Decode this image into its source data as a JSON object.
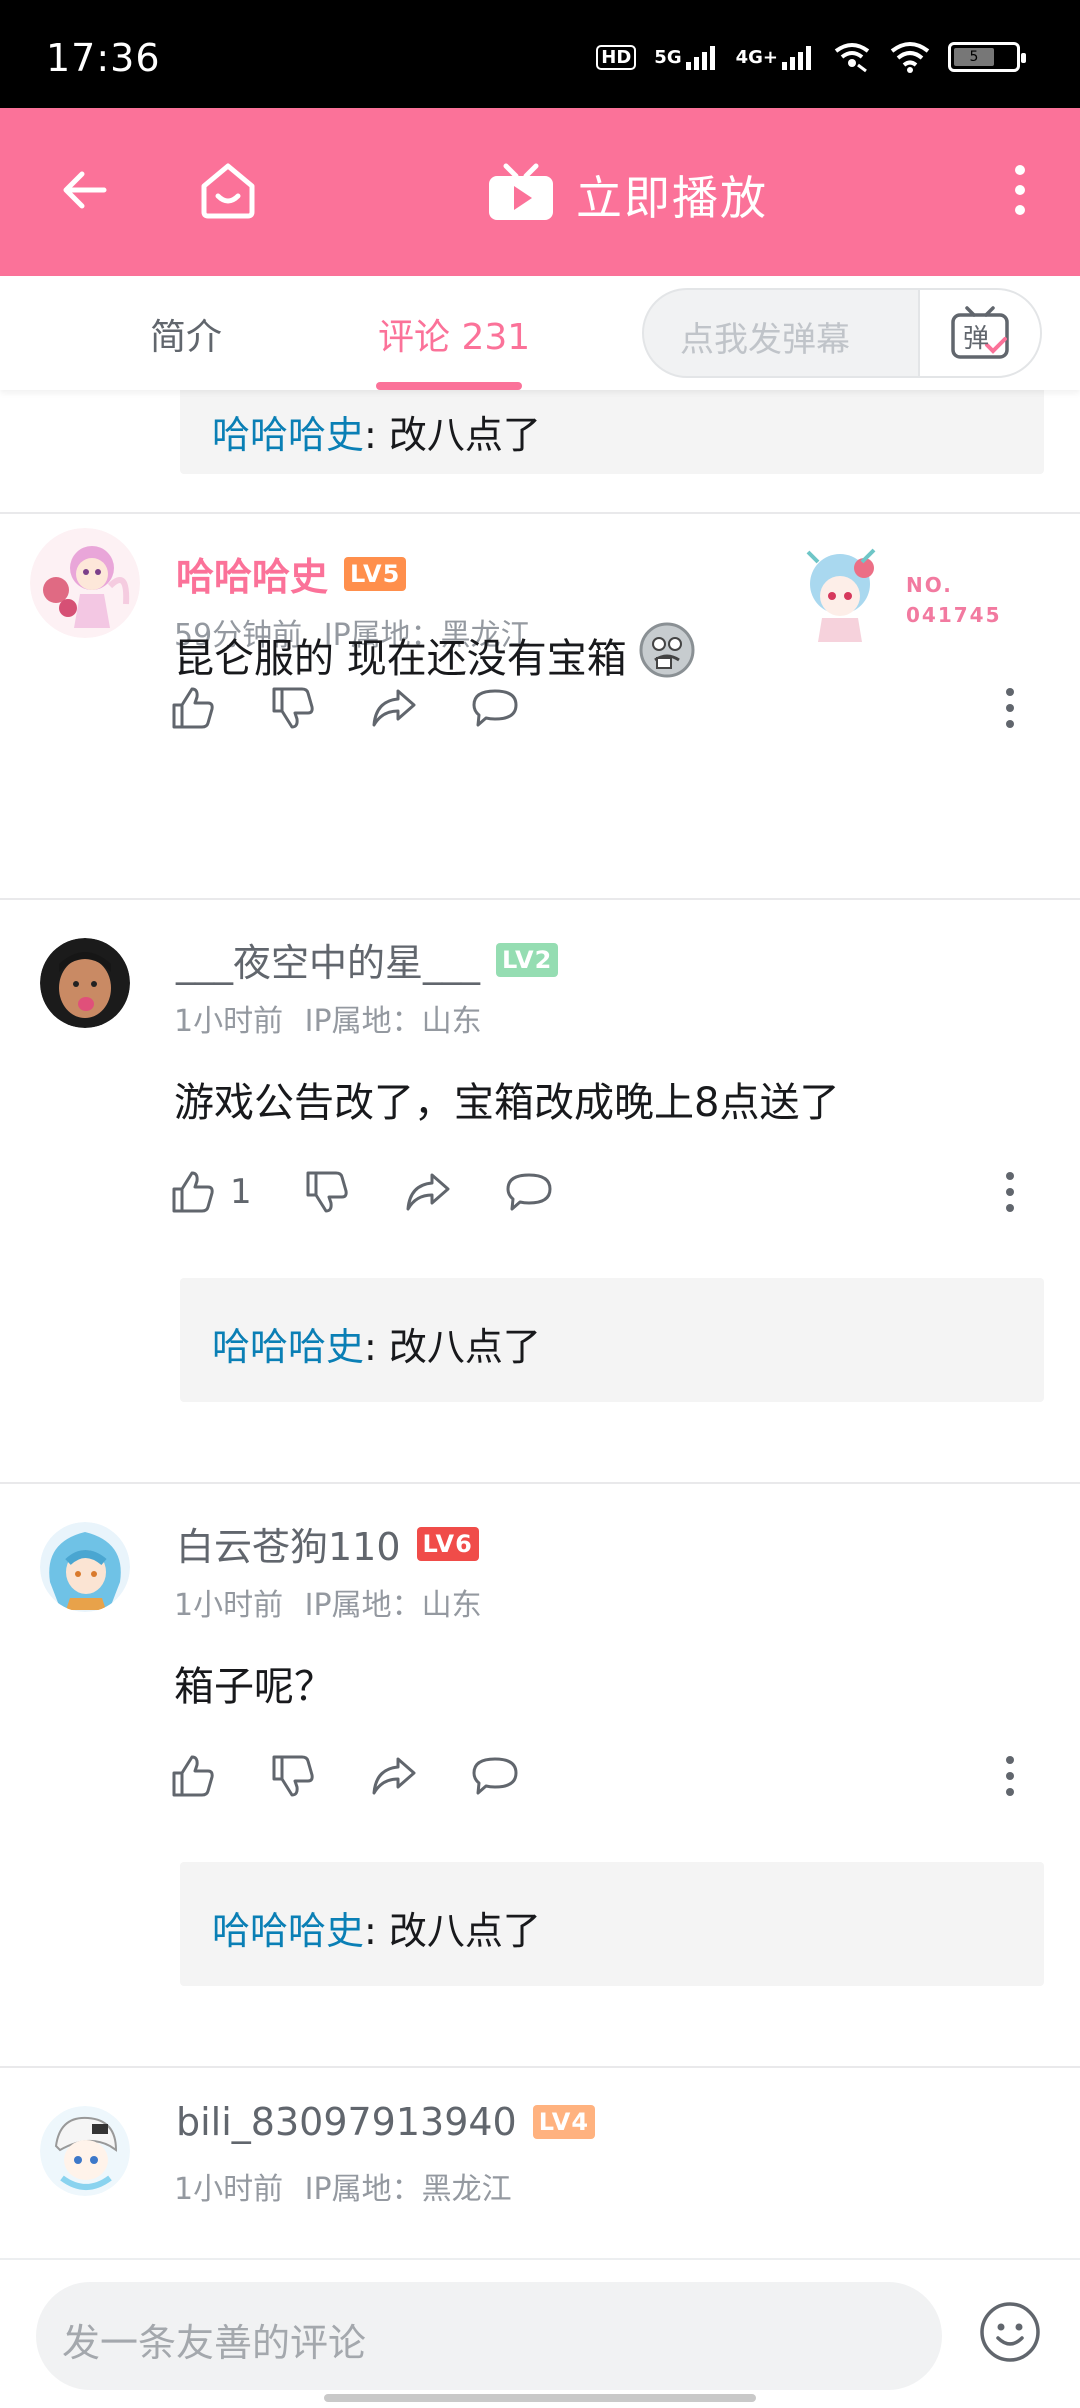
{
  "status_bar": {
    "time": "17:36",
    "hd_label": "HD",
    "net1": "5G",
    "net2": "4G+",
    "battery_level": "5"
  },
  "header": {
    "back_icon": "arrow-left-icon",
    "home_icon": "home-icon",
    "tv_icon": "bilibili-tv-icon",
    "play_label": "立即播放",
    "more_icon": "more-vertical-icon",
    "background": "#fb7299"
  },
  "tabs": {
    "intro": "简介",
    "comments": "评论",
    "comments_count": "231",
    "danmaku_placeholder": "点我发弹幕",
    "danmaku_btn": "弹"
  },
  "top_partial_reply": {
    "name": "哈哈哈史",
    "text": ": 改八点了"
  },
  "comments": [
    {
      "username": "哈哈哈史",
      "level": "LV5",
      "level_color": "#ff8f4c",
      "time": "59分钟前",
      "location": "IP属地：黑龙江",
      "text": "昆仑服的 现在还没有宝箱",
      "fan_badge": "NO.\n041745",
      "like_count": "",
      "reply": null
    },
    {
      "username": "___夜空中的星___",
      "level": "LV2",
      "level_color": "#95ddb2",
      "time": "1小时前",
      "location": "IP属地：山东",
      "text": "游戏公告改了，宝箱改成晚上8点送了",
      "like_count": "1",
      "reply": {
        "name": "哈哈哈史",
        "text": ": 改八点了"
      }
    },
    {
      "username": "白云苍狗110",
      "level": "LV6",
      "level_color": "#f04c49",
      "time": "1小时前",
      "location": "IP属地：山东",
      "text": "箱子呢？",
      "like_count": "",
      "reply": {
        "name": "哈哈哈史",
        "text": ": 改八点了"
      }
    },
    {
      "username": "bili_83097913940",
      "level": "LV4",
      "level_color": "#ffb27f",
      "time": "1小时前",
      "location": "IP属地：黑龙江"
    }
  ],
  "bottom": {
    "input_placeholder": "发一条友善的评论",
    "emoji_icon": "emoji-face-icon"
  }
}
